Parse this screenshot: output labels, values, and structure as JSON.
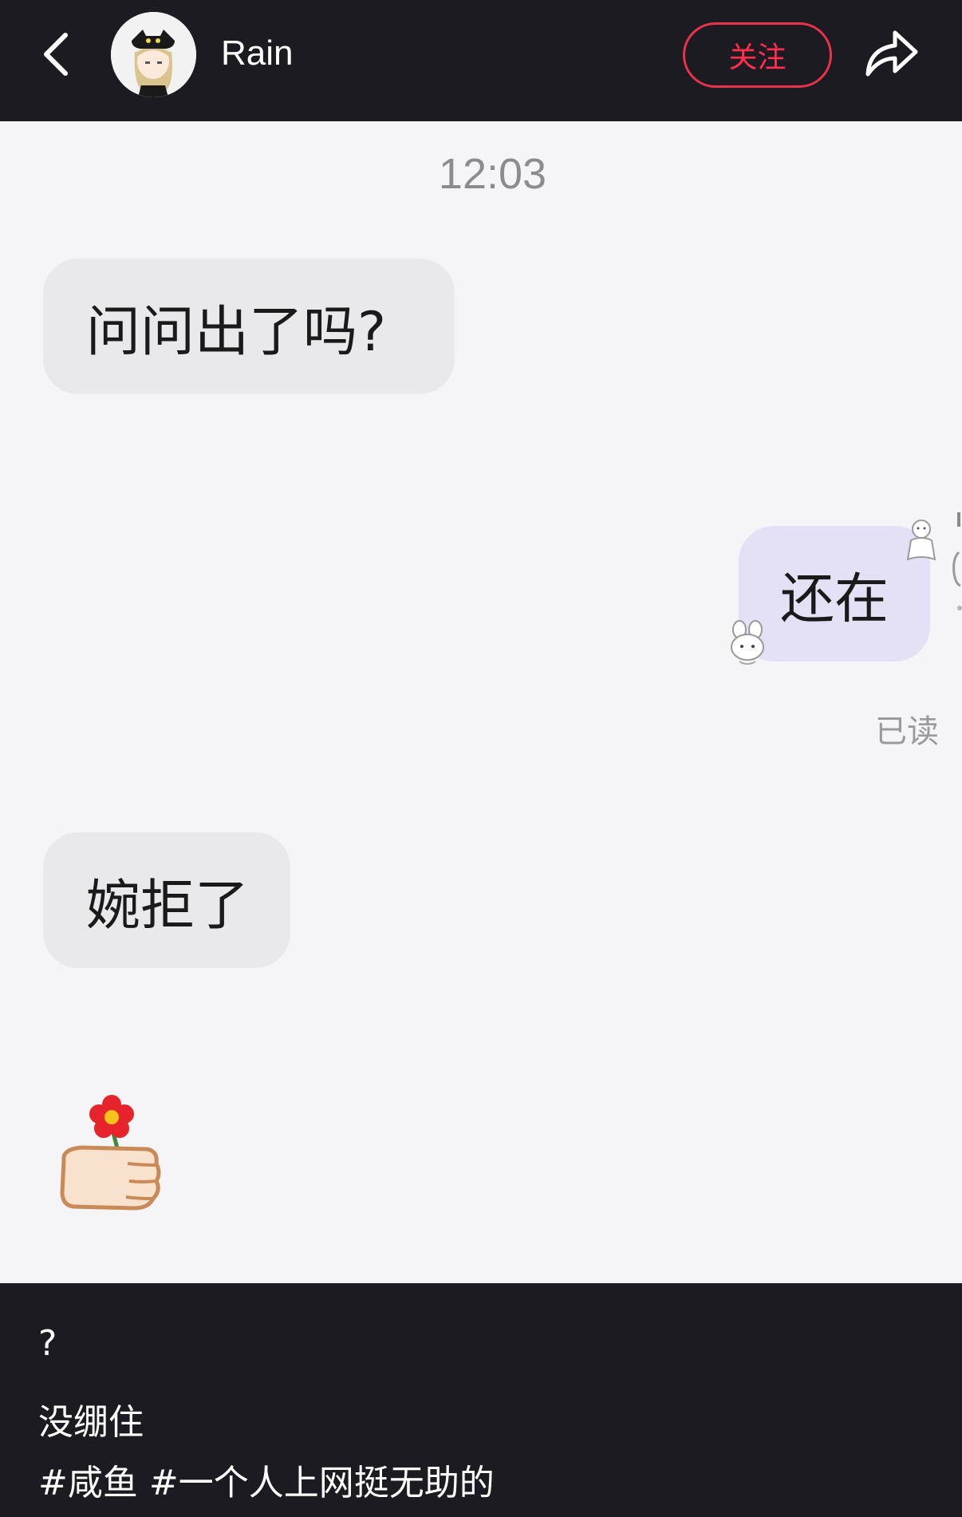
{
  "header": {
    "username": "Rain",
    "follow_label": "关注"
  },
  "chat": {
    "timestamp": "12:03",
    "messages": [
      {
        "side": "left",
        "text": "问问出了吗?"
      },
      {
        "side": "right",
        "text": "还在"
      },
      {
        "side": "left",
        "text": "婉拒了"
      }
    ],
    "read_status": "已读"
  },
  "caption": {
    "line1": "?",
    "line2": "没绷住",
    "hashtags": [
      "#咸鱼",
      "#一个人上网挺无助的"
    ]
  },
  "colors": {
    "dark_bg": "#1c1b22",
    "chat_bg": "#f5f5f7",
    "left_bubble": "#e9e9ec",
    "right_bubble": "#e4e0f6",
    "follow_red": "#ff2e4d"
  }
}
